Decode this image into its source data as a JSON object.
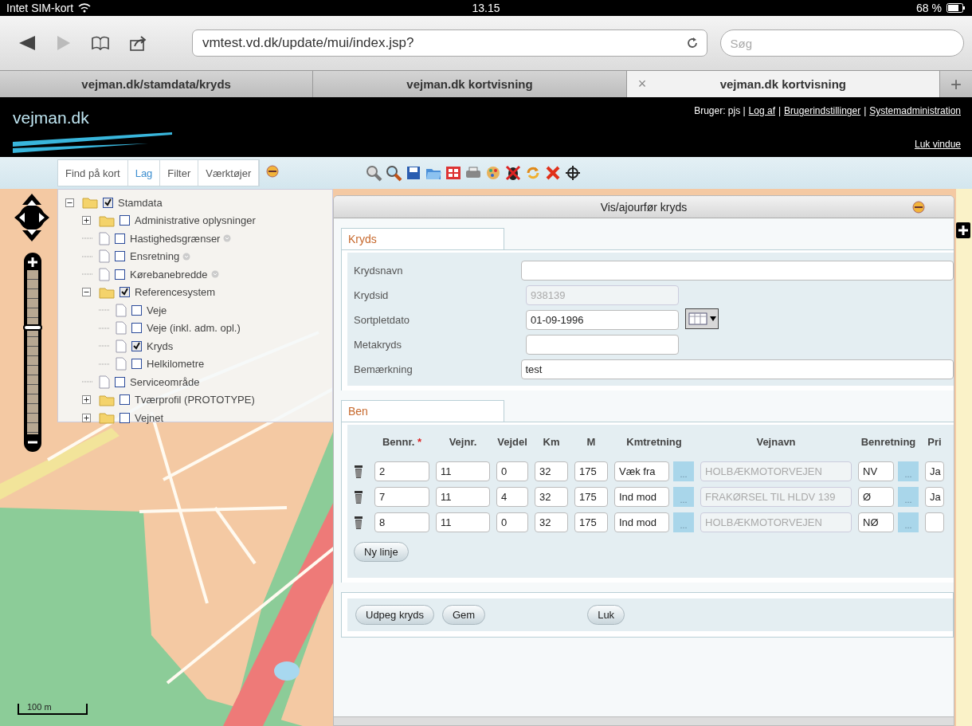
{
  "status_bar": {
    "carrier": "Intet SIM-kort",
    "time": "13.15",
    "battery": "68 %"
  },
  "browser": {
    "url": "vmtest.vd.dk/update/mui/index.jsp?",
    "search_placeholder": "Søg",
    "tabs": [
      {
        "label": "vejman.dk/stamdata/kryds",
        "selected": false
      },
      {
        "label": "vejman.dk kortvisning",
        "selected": false
      },
      {
        "label": "vejman.dk kortvisning",
        "selected": true,
        "close": "×"
      }
    ],
    "new_tab": "+"
  },
  "header": {
    "logo": "vejman.dk",
    "user_bar": [
      {
        "kind": "text",
        "text": "Bruger: pjs |"
      },
      {
        "kind": "link",
        "text": "Log af"
      },
      {
        "kind": "text",
        "text": "|"
      },
      {
        "kind": "link",
        "text": "Brugerindstillinger"
      },
      {
        "kind": "text",
        "text": "|"
      },
      {
        "kind": "link",
        "text": "Systemadministration"
      }
    ],
    "close_link": "Luk vindue"
  },
  "panel_tabs": [
    {
      "label": "Find på kort",
      "selected": false
    },
    {
      "label": "Lag",
      "selected": true
    },
    {
      "label": "Filter",
      "selected": false
    },
    {
      "label": "Værktøjer",
      "selected": false
    }
  ],
  "tree": [
    {
      "kind": "folder",
      "label": "Stamdata",
      "checked": true,
      "expanded": true,
      "children": [
        {
          "kind": "folder",
          "label": "Administrative oplysninger",
          "checked": false,
          "expanded": false
        },
        {
          "kind": "page",
          "label": "Hastighedsgrænser",
          "checked": false,
          "info": true
        },
        {
          "kind": "page",
          "label": "Ensretning",
          "checked": false,
          "info": true
        },
        {
          "kind": "page",
          "label": "Kørebanebredde",
          "checked": false,
          "info": true
        },
        {
          "kind": "folder",
          "label": "Referencesystem",
          "checked": true,
          "expanded": true,
          "children": [
            {
              "kind": "page",
              "label": "Veje",
              "checked": false
            },
            {
              "kind": "page",
              "label": "Veje (inkl. adm. opl.)",
              "checked": false
            },
            {
              "kind": "page",
              "label": "Kryds",
              "checked": true
            },
            {
              "kind": "page",
              "label": "Helkilometre",
              "checked": false
            }
          ]
        },
        {
          "kind": "page",
          "label": "Serviceområde",
          "checked": false
        },
        {
          "kind": "folder",
          "label": "Tværprofil (PROTOTYPE)",
          "checked": false,
          "expanded": false
        },
        {
          "kind": "folder",
          "label": "Vejnet",
          "checked": false,
          "expanded": false
        }
      ]
    }
  ],
  "map": {
    "zoom": {
      "level": 0.65
    },
    "scale": "100 m"
  },
  "dialog": {
    "title": "Vis/ajourfør kryds",
    "kryds": {
      "tab": "Kryds",
      "fields": [
        {
          "kind": "wide",
          "label": "Krydsnavn"
        },
        {
          "kind": "readonly",
          "label": "Krydsid",
          "value": "938139"
        },
        {
          "kind": "date",
          "label": "Sortpletdato",
          "value": "01-09-1996"
        },
        {
          "kind": "short",
          "label": "Metakryds"
        },
        {
          "kind": "wide",
          "label": "Bemærkning",
          "value": "test"
        }
      ]
    },
    "ben": {
      "tab": "Ben",
      "columns": [
        {
          "label": "Bennr.",
          "mark": "*"
        },
        {
          "label": "Vejnr."
        },
        {
          "label": "Vejdel"
        },
        {
          "label": "Km"
        },
        {
          "label": "M"
        },
        {
          "label": "Kmtretning"
        },
        {
          "label": "Vejnavn"
        },
        {
          "label": "Benretning"
        },
        {
          "label": "Pri"
        }
      ],
      "rows": [
        {
          "cells": [
            {
              "kind": "input",
              "value": "2"
            },
            {
              "kind": "input",
              "value": "11"
            },
            {
              "kind": "input",
              "value": "0"
            },
            {
              "kind": "input",
              "value": "32"
            },
            {
              "kind": "input",
              "value": "175"
            },
            {
              "kind": "input",
              "value": "Væk fra",
              "picker": "..."
            },
            {
              "kind": "readonly",
              "value": "HOLBÆKMOTORVEJEN"
            },
            {
              "kind": "input",
              "value": "NV",
              "picker": "..."
            },
            {
              "kind": "input",
              "value": "Ja"
            }
          ]
        },
        {
          "cells": [
            {
              "kind": "input",
              "value": "7"
            },
            {
              "kind": "input",
              "value": "11"
            },
            {
              "kind": "input",
              "value": "4"
            },
            {
              "kind": "input",
              "value": "32"
            },
            {
              "kind": "input",
              "value": "175"
            },
            {
              "kind": "input",
              "value": "Ind mod",
              "picker": "..."
            },
            {
              "kind": "readonly",
              "value": "FRAKØRSEL TIL HLDV 139"
            },
            {
              "kind": "input",
              "value": "Ø",
              "picker": "..."
            },
            {
              "kind": "input",
              "value": "Ja"
            }
          ]
        },
        {
          "cells": [
            {
              "kind": "input",
              "value": "8"
            },
            {
              "kind": "input",
              "value": "11"
            },
            {
              "kind": "input",
              "value": "0"
            },
            {
              "kind": "input",
              "value": "32"
            },
            {
              "kind": "input",
              "value": "175"
            },
            {
              "kind": "input",
              "value": "Ind mod",
              "picker": "..."
            },
            {
              "kind": "readonly",
              "value": "HOLBÆKMOTORVEJEN"
            },
            {
              "kind": "input",
              "value": "NØ",
              "picker": "..."
            },
            {
              "kind": "input"
            }
          ]
        }
      ],
      "add_button": "Ny linje"
    },
    "buttons": [
      {
        "kind": "action",
        "label": "Udpeg kryds"
      },
      {
        "kind": "action",
        "label": "Gem"
      },
      {
        "kind": "close",
        "label": "Luk"
      }
    ]
  }
}
